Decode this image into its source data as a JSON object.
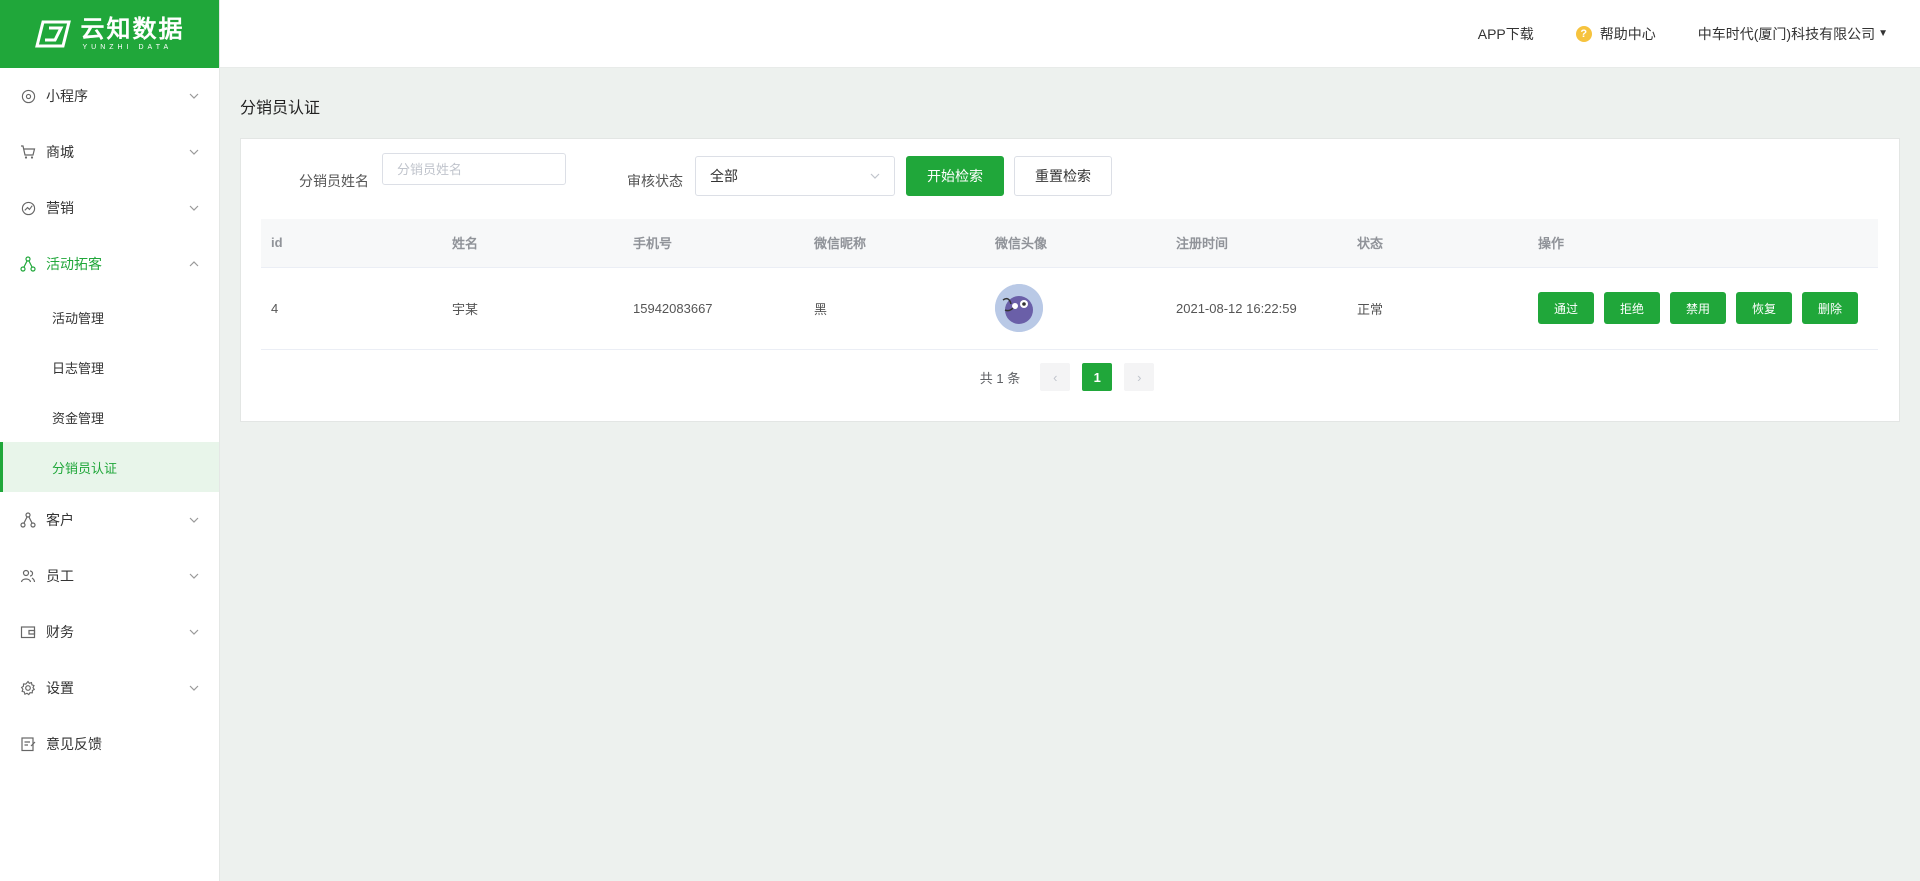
{
  "brand": {
    "name_cn": "云知数据",
    "name_en": "YUNZHI DATA",
    "color": "#20a73a"
  },
  "header": {
    "app_download": "APP下载",
    "help_center": "帮助中心",
    "company": "中车时代(厦门)科技有限公司"
  },
  "sidebar": {
    "items": [
      {
        "label": "小程序",
        "icon": "miniprogram-icon"
      },
      {
        "label": "商城",
        "icon": "cart-icon"
      },
      {
        "label": "营销",
        "icon": "marketing-icon"
      },
      {
        "label": "活动拓客",
        "icon": "activity-icon",
        "expanded": true
      },
      {
        "label": "客户",
        "icon": "customer-icon"
      },
      {
        "label": "员工",
        "icon": "staff-icon"
      },
      {
        "label": "财务",
        "icon": "wallet-icon"
      },
      {
        "label": "设置",
        "icon": "gear-icon"
      },
      {
        "label": "意见反馈",
        "icon": "feedback-icon"
      }
    ],
    "sub_items": [
      {
        "label": "活动管理"
      },
      {
        "label": "日志管理"
      },
      {
        "label": "资金管理"
      },
      {
        "label": "分销员认证",
        "selected": true
      }
    ]
  },
  "page": {
    "title": "分销员认证"
  },
  "filters": {
    "name_label": "分销员姓名",
    "name_placeholder": "分销员姓名",
    "status_label": "审核状态",
    "status_value": "全部",
    "search_button": "开始检索",
    "reset_button": "重置检索"
  },
  "table": {
    "columns": [
      "id",
      "姓名",
      "手机号",
      "微信昵称",
      "微信头像",
      "注册时间",
      "状态",
      "操作"
    ],
    "rows": [
      {
        "id": "4",
        "name": "宇某",
        "phone": "15942083667",
        "nickname": "黑",
        "registered": "2021-08-12 16:22:59",
        "status": "正常"
      }
    ],
    "actions": [
      "通过",
      "拒绝",
      "禁用",
      "恢复",
      "删除"
    ]
  },
  "pagination": {
    "total_text": "共 1 条",
    "current": "1",
    "prev": "‹",
    "next": "›"
  }
}
